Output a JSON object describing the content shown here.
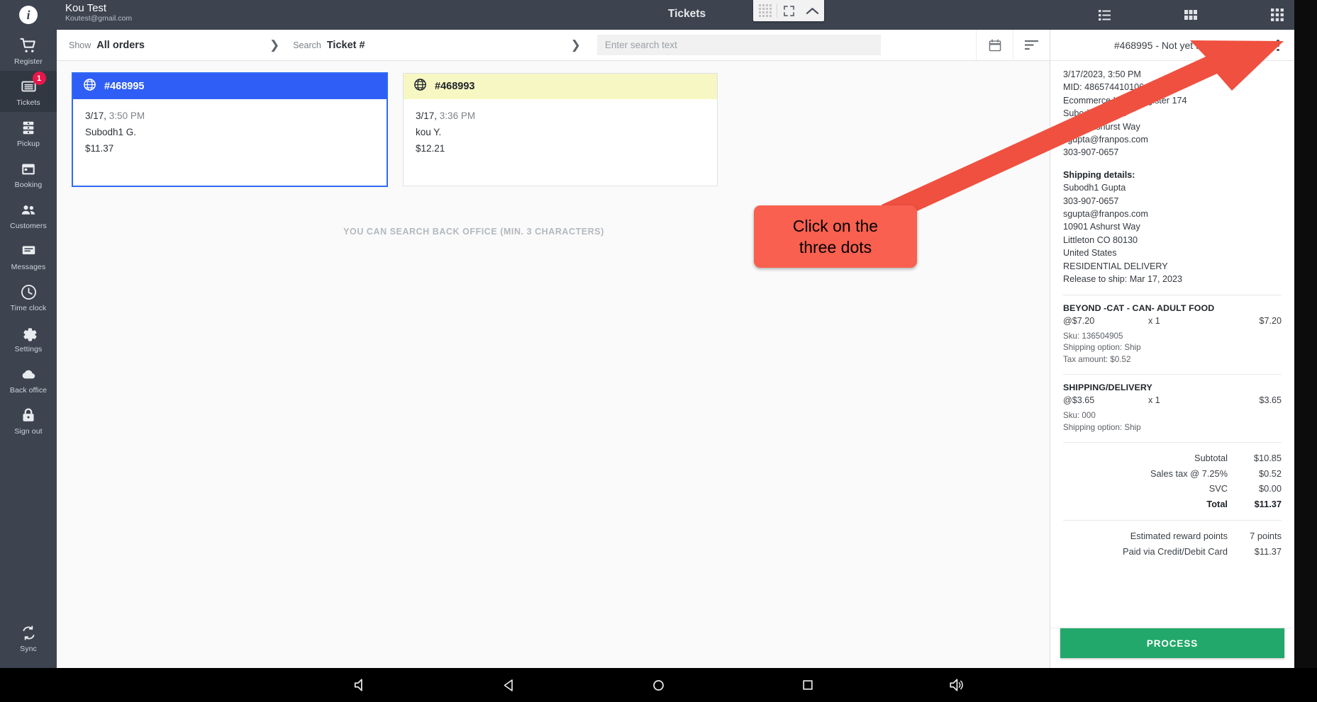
{
  "account": {
    "name": "Kou Test",
    "email": "Koutest@gmail.com"
  },
  "header": {
    "title": "Tickets",
    "view_modes": [
      {
        "name": "list-view",
        "label": "List view"
      },
      {
        "name": "medium-grid-view",
        "label": "Medium grid view"
      },
      {
        "name": "small-grid-view",
        "label": "Small grid view"
      }
    ],
    "float_widget": {
      "drag_handle": "dot-grid",
      "expand": "expand-icon",
      "collapse": "chevron-up-icon"
    }
  },
  "sidebar": {
    "logo": "i",
    "items": [
      {
        "label": "Register",
        "icon": "cart-icon",
        "active": false,
        "badge": ""
      },
      {
        "label": "Tickets",
        "icon": "ticket-icon",
        "active": true,
        "badge": "1"
      },
      {
        "label": "Pickup",
        "icon": "pickup-icon",
        "active": false,
        "badge": ""
      },
      {
        "label": "Booking",
        "icon": "calendar-icon",
        "active": false,
        "badge": ""
      },
      {
        "label": "Customers",
        "icon": "people-icon",
        "active": false,
        "badge": ""
      },
      {
        "label": "Messages",
        "icon": "message-icon",
        "active": false,
        "badge": ""
      },
      {
        "label": "Time clock",
        "icon": "clock-icon",
        "active": false,
        "badge": ""
      },
      {
        "label": "Settings",
        "icon": "gear-icon",
        "active": false,
        "badge": ""
      },
      {
        "label": "Back office",
        "icon": "cloud-icon",
        "active": false,
        "badge": ""
      },
      {
        "label": "Sign out",
        "icon": "lock-icon",
        "active": false,
        "badge": ""
      }
    ],
    "sync": {
      "label": "Sync",
      "icon": "sync-icon"
    }
  },
  "filterbar": {
    "show_label": "Show",
    "show_value": "All orders",
    "search_label": "Search",
    "search_value": "Ticket #",
    "search_placeholder": "Enter search text",
    "input_value": "",
    "calendar_icon": "calendar-icon",
    "sort_icon": "sort-icon"
  },
  "main": {
    "empty_hint": "YOU CAN SEARCH BACK OFFICE (MIN. 3 CHARACTERS)",
    "cards": [
      {
        "number": "#468995",
        "icon": "globe-icon",
        "header_style": "blue",
        "selected": true,
        "date": "3/17,",
        "time": "3:50 PM",
        "customer": "Subodh1 G.",
        "amount": "$11.37"
      },
      {
        "number": "#468993",
        "icon": "globe-icon",
        "header_style": "yellow",
        "selected": false,
        "date": "3/17,",
        "time": "3:36 PM",
        "customer": "kou Y.",
        "amount": "$12.21"
      }
    ]
  },
  "detail": {
    "title": "#468995 - Not yet shipped",
    "kebab_icon": "more-vertical-icon",
    "meta": [
      "3/17/2023, 3:50 PM",
      "MID: 4865744101064525302",
      "Ecommerce U. @ Register 174",
      "Subodh1 Gupta",
      "10901 Ashurst Way",
      "sgupta@franpos.com",
      "303-907-0657"
    ],
    "shipping_heading": "Shipping details:",
    "shipping": [
      "Subodh1 Gupta",
      "303-907-0657",
      "sgupta@franpos.com",
      "10901 Ashurst Way",
      "Littleton CO 80130",
      "United States",
      "RESIDENTIAL DELIVERY",
      "Release to ship: Mar 17, 2023"
    ],
    "items": [
      {
        "name": "BEYOND -CAT - CAN- ADULT FOOD",
        "unit": "@$7.20",
        "qty": "x  1",
        "amount": "$7.20",
        "meta": [
          "Sku: 136504905",
          "Shipping option: Ship",
          "Tax amount: $0.52"
        ]
      },
      {
        "name": "SHIPPING/DELIVERY",
        "unit": "@$3.65",
        "qty": "x  1",
        "amount": "$3.65",
        "meta": [
          "Sku: 000",
          "Shipping option: Ship"
        ]
      }
    ],
    "totals": [
      {
        "label": "Subtotal",
        "value": "$10.85",
        "bold": false
      },
      {
        "label": "Sales tax @ 7.25%",
        "value": "$0.52",
        "bold": false
      },
      {
        "label": "SVC",
        "value": "$0.00",
        "bold": false
      },
      {
        "label": "Total",
        "value": "$11.37",
        "bold": true
      }
    ],
    "extras": [
      {
        "label": "Estimated reward points",
        "value": "7 points"
      },
      {
        "label": "Paid via Credit/Debit Card",
        "value": "$11.37"
      }
    ],
    "process_label": "PROCESS"
  },
  "annotation": {
    "text_line1": "Click on the",
    "text_line2": "three dots",
    "color": "#f9604f",
    "arrow_color": "#f0503f"
  },
  "bottom_nav": [
    {
      "name": "volume-down-icon"
    },
    {
      "name": "back-icon"
    },
    {
      "name": "home-icon"
    },
    {
      "name": "recents-icon"
    },
    {
      "name": "volume-up-icon"
    }
  ]
}
